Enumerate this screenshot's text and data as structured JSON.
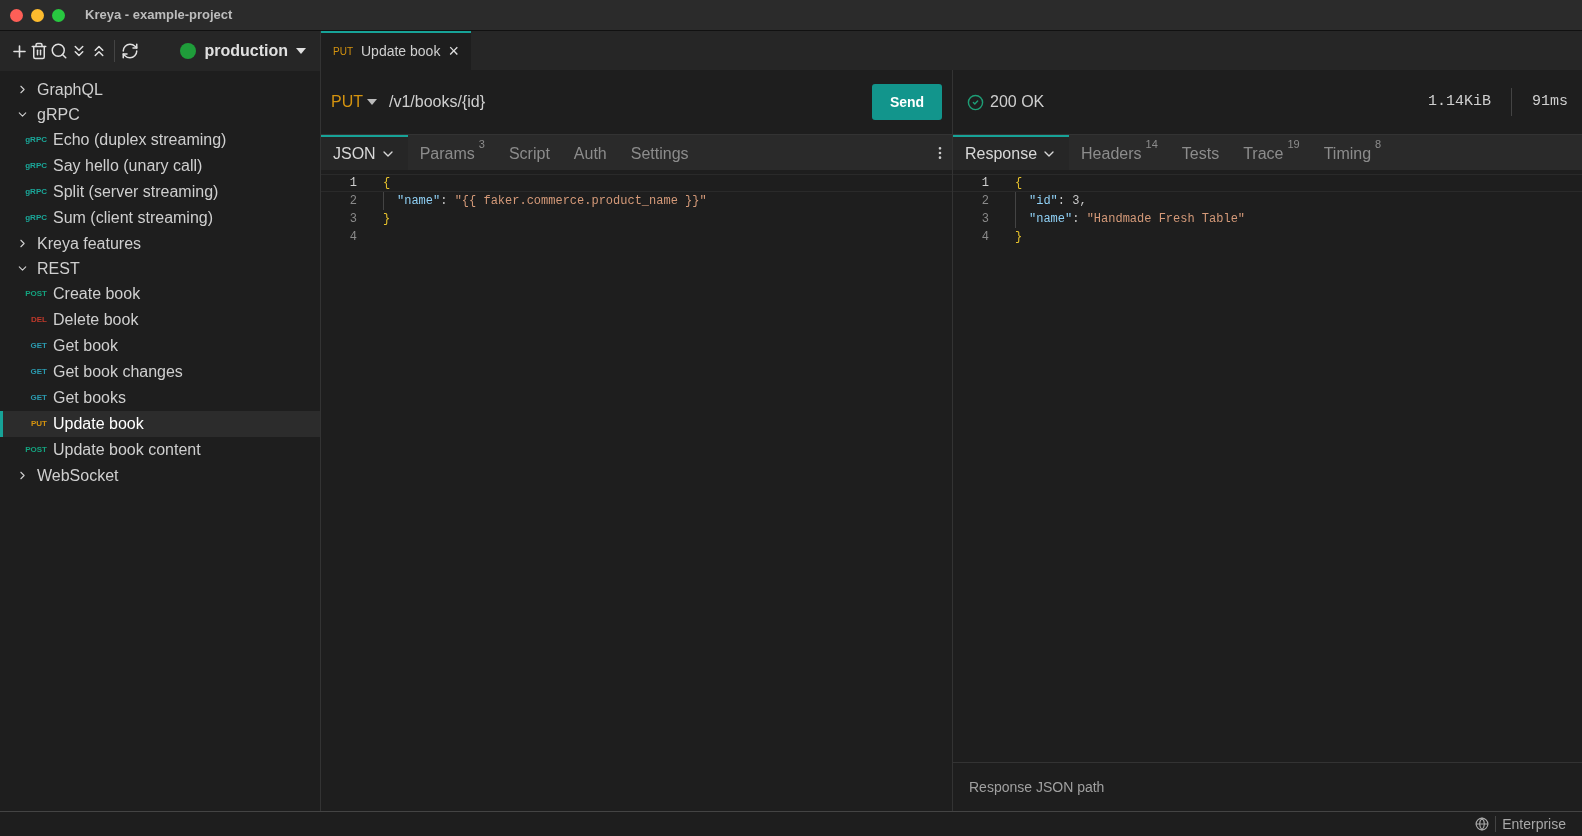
{
  "window": {
    "title": "Kreya - example-project"
  },
  "toolbar": {
    "environment": {
      "name": "production",
      "color": "#1f9d3a"
    }
  },
  "sidebar": {
    "items": [
      {
        "kind": "folder",
        "label": "GraphQL",
        "expanded": false
      },
      {
        "kind": "folder",
        "label": "gRPC",
        "expanded": true,
        "children": [
          {
            "kind": "op",
            "method": "gRPC",
            "color": "#1aa89a",
            "label": "Echo (duplex streaming)",
            "selected": false
          },
          {
            "kind": "op",
            "method": "gRPC",
            "color": "#1aa89a",
            "label": "Say hello (unary call)",
            "selected": false
          },
          {
            "kind": "op",
            "method": "gRPC",
            "color": "#1aa89a",
            "label": "Split (server streaming)",
            "selected": false
          },
          {
            "kind": "op",
            "method": "gRPC",
            "color": "#1aa89a",
            "label": "Sum (client streaming)",
            "selected": false
          }
        ]
      },
      {
        "kind": "folder",
        "label": "Kreya features",
        "expanded": false
      },
      {
        "kind": "folder",
        "label": "REST",
        "expanded": true,
        "children": [
          {
            "kind": "op",
            "method": "POST",
            "color": "#14a37f",
            "label": "Create book",
            "selected": false
          },
          {
            "kind": "op",
            "method": "DEL",
            "color": "#c0392b",
            "label": "Delete book",
            "selected": false
          },
          {
            "kind": "op",
            "method": "GET",
            "color": "#2b9bb0",
            "label": "Get book",
            "selected": false
          },
          {
            "kind": "op",
            "method": "GET",
            "color": "#2b9bb0",
            "label": "Get book changes",
            "selected": false
          },
          {
            "kind": "op",
            "method": "GET",
            "color": "#2b9bb0",
            "label": "Get books",
            "selected": false
          },
          {
            "kind": "op",
            "method": "PUT",
            "color": "#d4930f",
            "label": "Update book",
            "selected": true
          },
          {
            "kind": "op",
            "method": "POST",
            "color": "#14a37f",
            "label": "Update book content",
            "selected": false
          }
        ]
      },
      {
        "kind": "folder",
        "label": "WebSocket",
        "expanded": false
      }
    ]
  },
  "open_tabs": [
    {
      "method": "PUT",
      "label": "Update book",
      "close": "×",
      "selected": true
    }
  ],
  "request": {
    "method": "PUT",
    "url": "/v1/books/{id}",
    "send": "Send",
    "tabs": [
      {
        "label": "JSON",
        "dropdown": true,
        "selected": true
      },
      {
        "label": "Params",
        "badge": "3",
        "selected": false
      },
      {
        "label": "Script",
        "selected": false
      },
      {
        "label": "Auth",
        "selected": false
      },
      {
        "label": "Settings",
        "selected": false
      }
    ],
    "code": [
      {
        "number": "1",
        "tokens": [
          {
            "kind": "brace",
            "text": "{"
          }
        ]
      },
      {
        "number": "2",
        "indented": true,
        "tokens": [
          {
            "kind": "key",
            "text": "\"name\""
          },
          {
            "kind": "punct",
            "text": ": "
          },
          {
            "kind": "string",
            "text": "\"{{ faker.commerce.product_name }}\""
          }
        ]
      },
      {
        "number": "3",
        "tokens": [
          {
            "kind": "brace",
            "text": "}"
          }
        ]
      },
      {
        "number": "4"
      }
    ]
  },
  "response": {
    "status": "200 OK",
    "size": "1.14KiB",
    "time": "91ms",
    "tabs": [
      {
        "label": "Response",
        "dropdown": true,
        "selected": true
      },
      {
        "label": "Headers",
        "badge": "14",
        "selected": false
      },
      {
        "label": "Tests",
        "selected": false
      },
      {
        "label": "Trace",
        "badge": "19",
        "selected": false
      },
      {
        "label": "Timing",
        "badge": "8",
        "selected": false
      }
    ],
    "code": [
      {
        "number": "1",
        "tokens": [
          {
            "kind": "brace",
            "text": "{"
          }
        ]
      },
      {
        "number": "2",
        "indented": true,
        "tokens": [
          {
            "kind": "key",
            "text": "\"id\""
          },
          {
            "kind": "punct",
            "text": ": "
          },
          {
            "kind": "number",
            "text": "3"
          },
          {
            "kind": "punct",
            "text": ","
          }
        ]
      },
      {
        "number": "3",
        "indented": true,
        "tokens": [
          {
            "kind": "key",
            "text": "\"name\""
          },
          {
            "kind": "punct",
            "text": ": "
          },
          {
            "kind": "string",
            "text": "\"Handmade Fresh Table\""
          }
        ]
      },
      {
        "number": "4",
        "tokens": [
          {
            "kind": "brace",
            "text": "}"
          }
        ]
      }
    ],
    "json_path": {
      "placeholder": "Response JSON path"
    }
  },
  "status_bar": {
    "edition": "Enterprise"
  }
}
